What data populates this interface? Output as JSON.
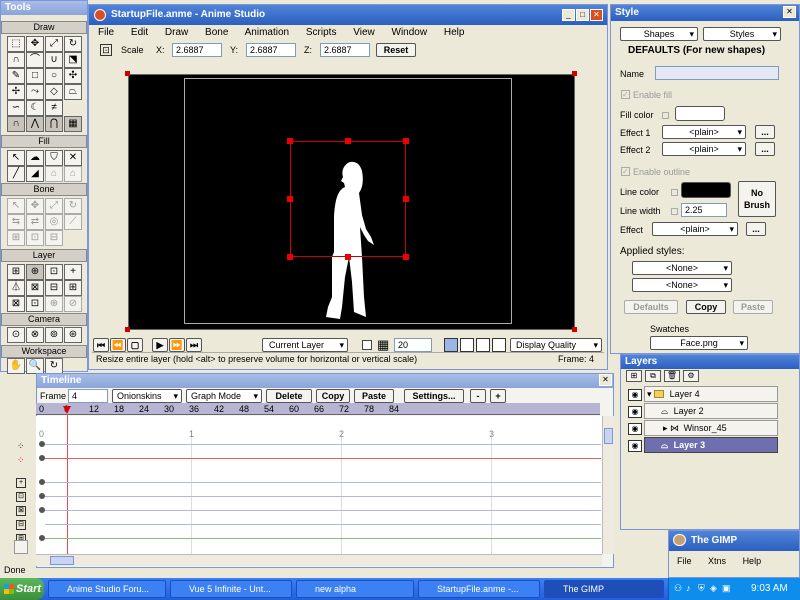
{
  "tools": {
    "title": "Tools",
    "sections": {
      "draw": "Draw",
      "fill": "Fill",
      "bone": "Bone",
      "layer": "Layer",
      "camera": "Camera",
      "workspace": "Workspace"
    }
  },
  "main": {
    "title": "StartupFile.anme - Anime Studio",
    "menu": [
      "File",
      "Edit",
      "Draw",
      "Bone",
      "Animation",
      "Scripts",
      "View",
      "Window",
      "Help"
    ],
    "scale_label": "Scale",
    "x_label": "X:",
    "x": "2.6887",
    "y_label": "Y:",
    "y": "2.6887",
    "z_label": "Z:",
    "z": "2.6887",
    "reset": "Reset",
    "layer_mode": "Current Layer",
    "frame_field": "20",
    "display_quality": "Display Quality",
    "status": "Resize entire layer (hold <alt> to preserve volume for horizontal or vertical scale)",
    "frame_status": "Frame: 4"
  },
  "timeline": {
    "title": "Timeline",
    "frame_label": "Frame",
    "frame_value": "4",
    "onionskins": "Onionskins",
    "graph_mode": "Graph Mode",
    "delete": "Delete",
    "copy": "Copy",
    "paste": "Paste",
    "settings": "Settings...",
    "minus": "-",
    "plus": "+",
    "ruler": [
      "0",
      "6",
      "12",
      "18",
      "24",
      "30",
      "36",
      "42",
      "48",
      "54",
      "60",
      "66",
      "72",
      "78",
      "84"
    ],
    "seconds": [
      "0",
      "1",
      "2",
      "3"
    ]
  },
  "style": {
    "title": "Style",
    "shapes": "Shapes",
    "styles": "Styles",
    "defaults": "DEFAULTS (For new shapes)",
    "name_label": "Name",
    "enable_fill": "Enable fill",
    "fill_color": "Fill color",
    "effect1": "Effect 1",
    "effect1_value": "<plain>",
    "effect2": "Effect 2",
    "effect2_value": "<plain>",
    "ellipsis": "...",
    "enable_outline": "Enable outline",
    "line_color": "Line color",
    "line_width": "Line width",
    "line_width_value": "2.25",
    "no_brush": "No Brush",
    "effect": "Effect",
    "effect_value": "<plain>",
    "applied_styles": "Applied styles:",
    "none1": "<None>",
    "none2": "<None>",
    "defaults_btn": "Defaults",
    "copy_btn": "Copy",
    "paste_btn": "Paste",
    "swatches": "Swatches",
    "swatch_file": "Face.png"
  },
  "layers": {
    "title": "Layers",
    "items": [
      "Layer 4",
      "Layer 2",
      "Winsor_45",
      "Layer 3"
    ]
  },
  "gimp": {
    "title": "The GIMP",
    "menu": [
      "File",
      "Xtns",
      "Help"
    ]
  },
  "desktop": {
    "done": "Done"
  },
  "taskbar": {
    "start": "Start",
    "tasks": [
      "Anime Studio Foru...",
      "Vue 5 Infinite - Unt...",
      "new alpha",
      "StartupFile.anme -...",
      "The GIMP"
    ],
    "clock": "9:03 AM"
  }
}
